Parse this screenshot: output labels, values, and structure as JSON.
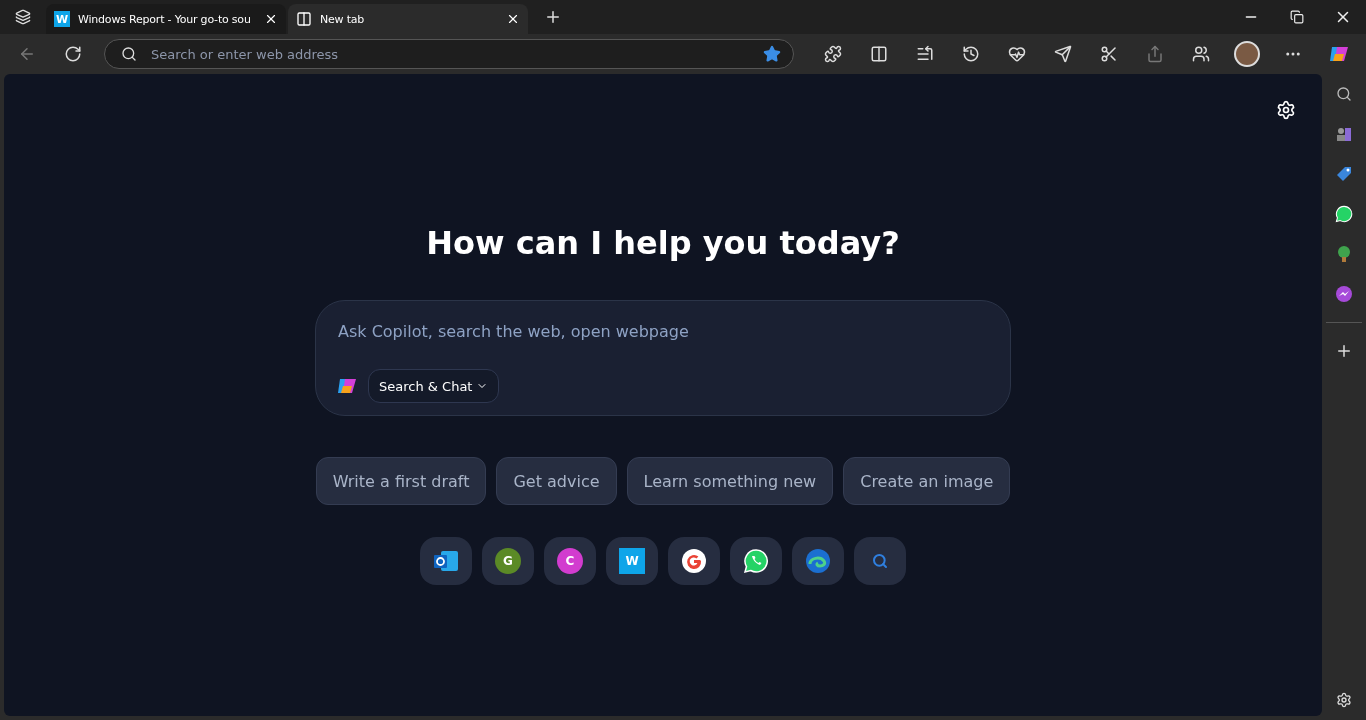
{
  "tabs": [
    {
      "title": "Windows Report - Your go-to sou",
      "favicon": "W",
      "kind": "site",
      "selected": false
    },
    {
      "title": "New tab",
      "kind": "newtab",
      "selected": true
    }
  ],
  "address_bar": {
    "placeholder": "Search or enter web address",
    "favorited": true
  },
  "heading": "How can I help you today?",
  "prompt": {
    "placeholder": "Ask Copilot, search the web, open webpage",
    "mode": "Search & Chat"
  },
  "suggestions": [
    "Write a first draft",
    "Get advice",
    "Learn something new",
    "Create an image"
  ],
  "shortcuts": [
    {
      "kind": "outlook"
    },
    {
      "kind": "letter",
      "letter": "G",
      "color": "#5b8a26"
    },
    {
      "kind": "letter",
      "letter": "C",
      "color": "#d23ccf"
    },
    {
      "kind": "square",
      "letter": "W",
      "color": "#0ea5e9"
    },
    {
      "kind": "google"
    },
    {
      "kind": "whatsapp"
    },
    {
      "kind": "edge"
    },
    {
      "kind": "search"
    }
  ]
}
